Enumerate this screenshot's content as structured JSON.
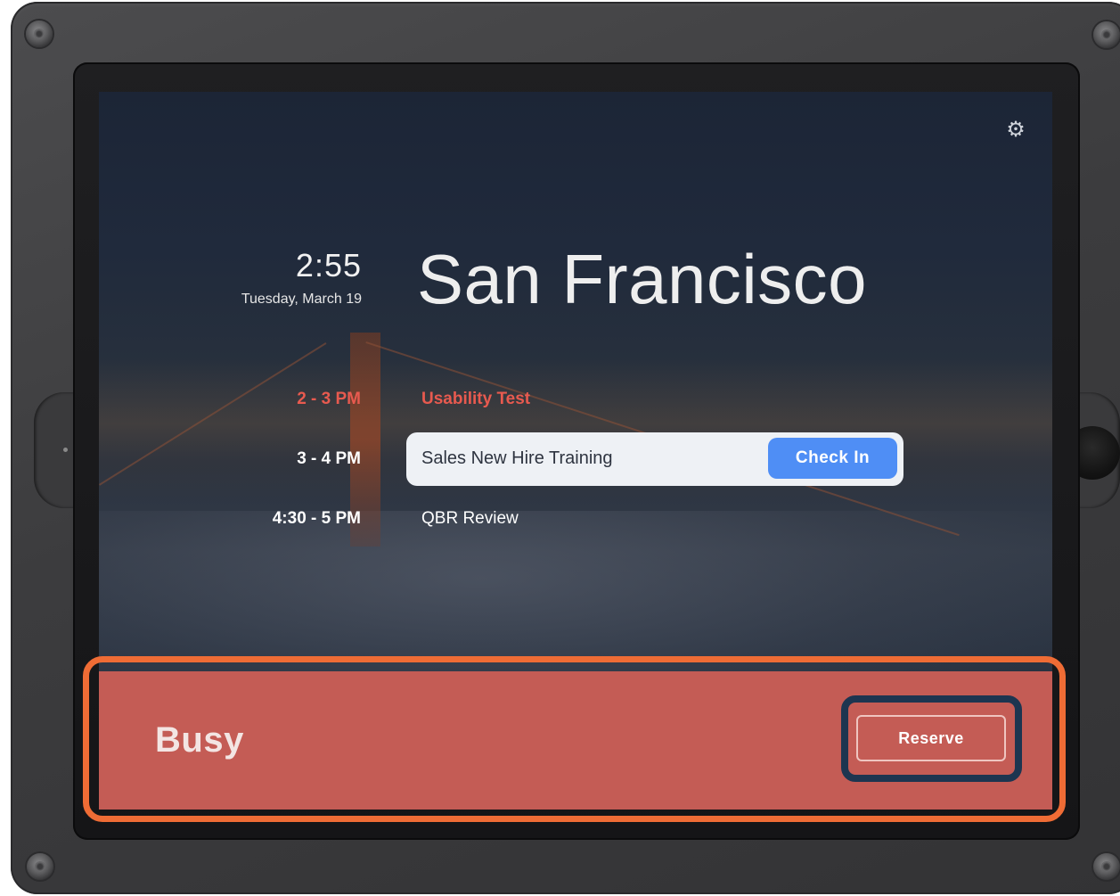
{
  "header": {
    "settings_icon": "gear-icon",
    "time": "2:55",
    "date": "Tuesday, March 19",
    "room_name": "San Francisco"
  },
  "schedule": [
    {
      "time": "2 - 3 PM",
      "title": "Usability Test",
      "state": "past"
    },
    {
      "time": "3 - 4 PM",
      "title": "Sales New Hire Training",
      "state": "current",
      "action_label": "Check In"
    },
    {
      "time": "4:30 - 5 PM",
      "title": "QBR Review",
      "state": "upcoming"
    }
  ],
  "status": {
    "label": "Busy",
    "action_label": "Reserve"
  },
  "colors": {
    "past_meeting": "#e85a4f",
    "checkin_button": "#4f8ef5",
    "busy_bar": "#c45c55",
    "highlight_outer": "#ef6c35",
    "highlight_inner": "#1d3550"
  }
}
